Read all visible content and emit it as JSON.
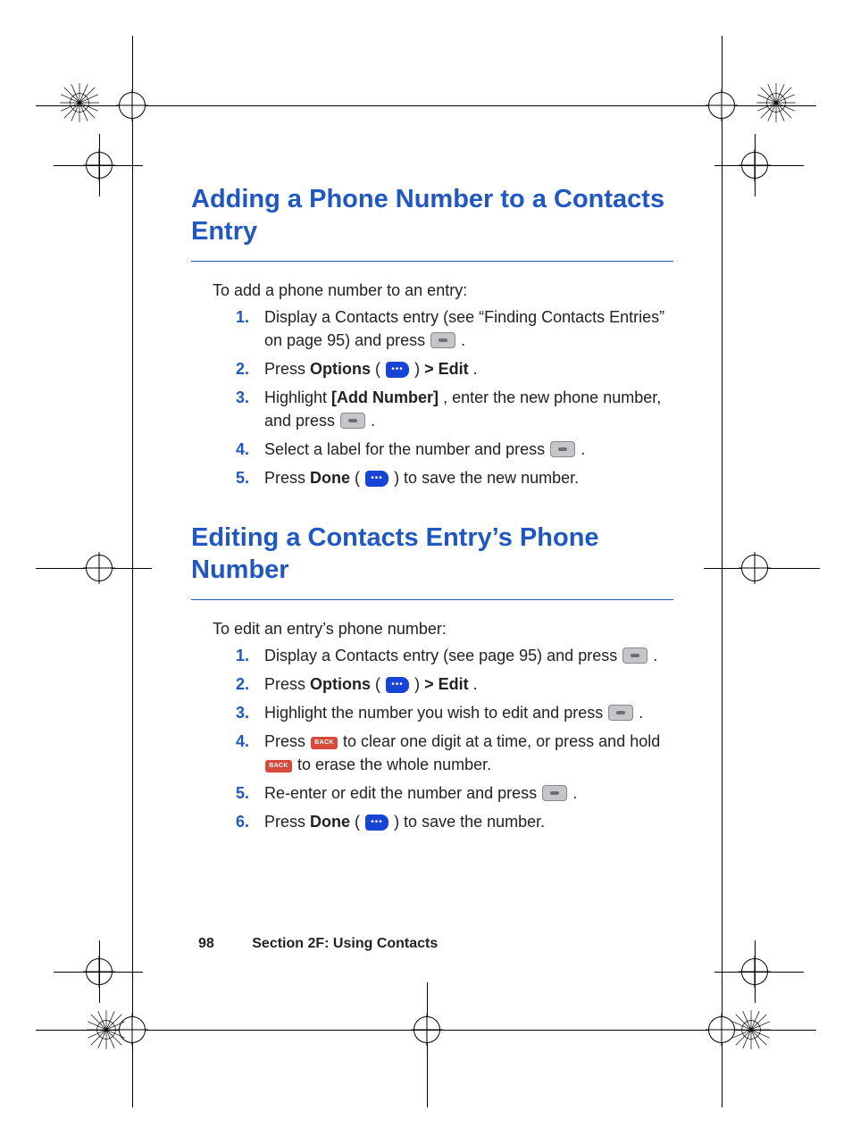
{
  "section1": {
    "title": "Adding a Phone Number to a Contacts Entry",
    "intro": "To add a phone number to an entry:",
    "steps": {
      "s1a": "Display a Contacts entry (see “Finding Contacts Entries” on page 95) and press ",
      "s1b": ".",
      "s2a": "Press ",
      "s2_opt": "Options",
      "s2b": " (",
      "s2c": ") ",
      "s2_gt": "> Edit",
      "s2d": ".",
      "s3a": "Highlight ",
      "s3_add": "[Add Number]",
      "s3b": ", enter the new phone number, and press ",
      "s3c": ".",
      "s4a": "Select a label for the number and press ",
      "s4b": ".",
      "s5a": "Press ",
      "s5_done": "Done",
      "s5b": " (",
      "s5c": ") to save the new number."
    }
  },
  "section2": {
    "title": "Editing a Contacts Entry’s Phone Number",
    "intro": "To edit an entry’s phone number:",
    "steps": {
      "s1a": "Display a Contacts entry (see page 95) and press ",
      "s1b": ".",
      "s2a": "Press ",
      "s2_opt": "Options",
      "s2b": " (",
      "s2c": ") ",
      "s2_gt": "> Edit",
      "s2d": ".",
      "s3a": "Highlight the number you wish to edit and press ",
      "s3b": ".",
      "s4a": "Press ",
      "s4b": " to clear one digit at a time, or press and hold ",
      "s4c": " to erase the whole number.",
      "s5a": "Re-enter or edit the number and press ",
      "s5b": ".",
      "s6a": "Press ",
      "s6_done": "Done",
      "s6b": " (",
      "s6c": ") to save the number."
    }
  },
  "footer": {
    "page": "98",
    "label": "Section 2F: Using Contacts"
  }
}
